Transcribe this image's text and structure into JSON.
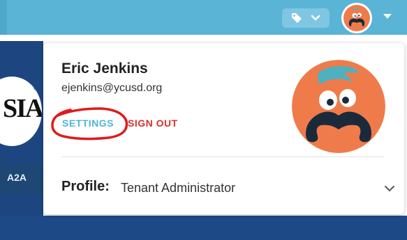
{
  "topbar": {
    "bg_color": "#59b4d6",
    "tag_icon": "tag-icon",
    "tag_menu_icon": "chevron-down-icon",
    "avatar_menu_icon": "caret-down-icon"
  },
  "background": {
    "logo_text": "SIA",
    "side_label": "A2A"
  },
  "user_menu": {
    "name": "Eric Jenkins",
    "email": "ejenkins@ycusd.org",
    "settings_label": "SETTINGS",
    "signout_label": "SIGN OUT",
    "settings_color": "#4cb4dc",
    "signout_color": "#d9302a",
    "highlight_color": "#e01b1b",
    "avatar_color": "#ef7b4b",
    "profile_label": "Profile:",
    "profile_value": "Tenant Administrator",
    "profile_menu_icon": "chevron-down-icon"
  }
}
